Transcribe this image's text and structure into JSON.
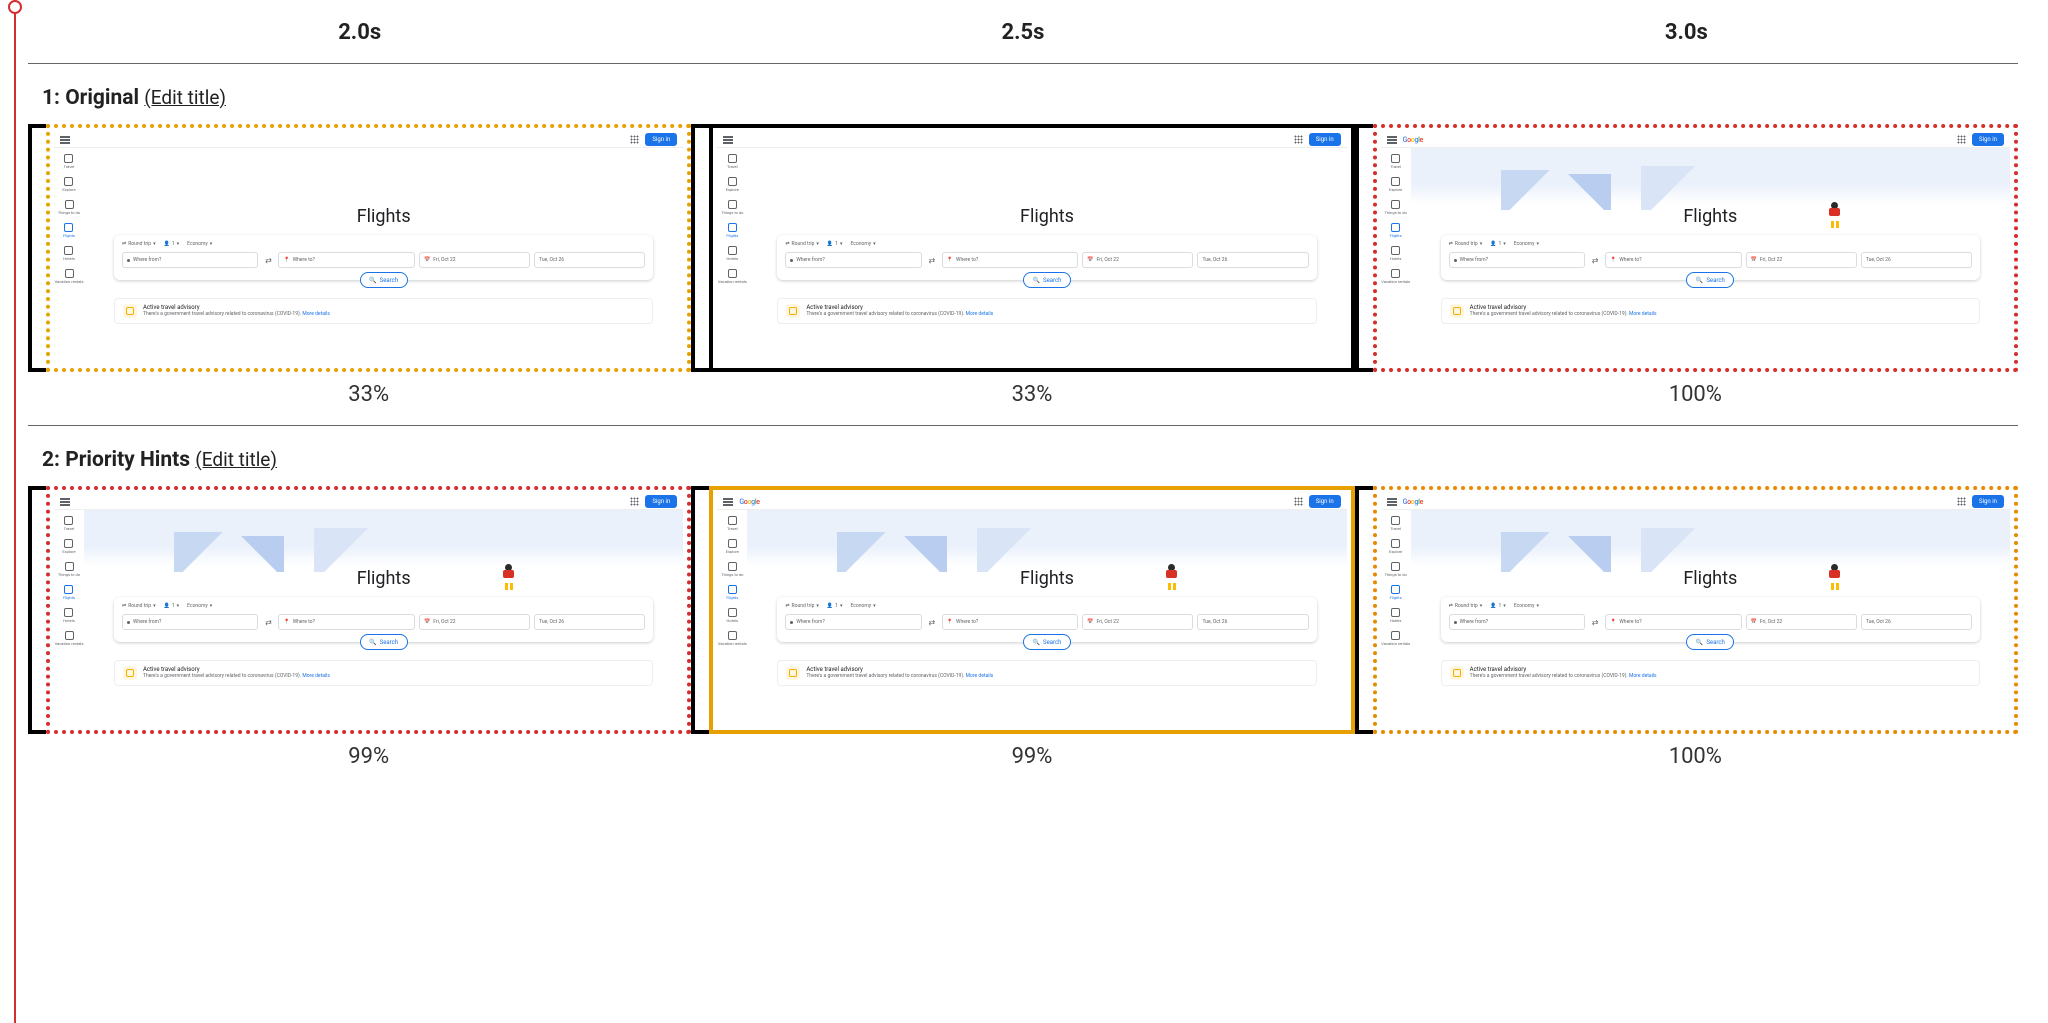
{
  "timeline": {
    "times": [
      "2.0s",
      "2.5s",
      "3.0s"
    ]
  },
  "variants": [
    {
      "num": "1",
      "name": "Original",
      "edit_label": "(Edit title)",
      "frames": [
        {
          "border": "bd-yellow-dot",
          "percent": "33%",
          "hero_loaded": false,
          "logo_loaded": false
        },
        {
          "border": "bd-black",
          "percent": "33%",
          "hero_loaded": false,
          "logo_loaded": false
        },
        {
          "border": "bd-red-dot",
          "percent": "100%",
          "hero_loaded": true,
          "logo_loaded": true
        }
      ]
    },
    {
      "num": "2",
      "name": "Priority Hints",
      "edit_label": "(Edit title)",
      "frames": [
        {
          "border": "bd-red-dot",
          "percent": "99%",
          "hero_loaded": true,
          "logo_loaded": false
        },
        {
          "border": "bd-orange",
          "percent": "99%",
          "hero_loaded": true,
          "logo_loaded": true
        },
        {
          "border": "bd-orange-dot",
          "percent": "100%",
          "hero_loaded": true,
          "logo_loaded": true
        }
      ]
    }
  ],
  "thumb": {
    "signin": "Sign in",
    "page_title": "Flights",
    "sidebar": [
      "Travel",
      "Explore",
      "Things to do",
      "Flights",
      "Hotels",
      "Vacation rentals"
    ],
    "active_sidebar_index": 3,
    "chips": {
      "trip": "Round trip",
      "pax": "1",
      "cabin": "Economy"
    },
    "fields": {
      "from_placeholder": "Where from?",
      "to_placeholder": "Where to?",
      "date1": "Fri, Oct 22",
      "date2": "Tue, Oct 26"
    },
    "search_label": "Search",
    "advisory": {
      "title": "Active travel advisory",
      "body": "There's a government travel advisory related to coronavirus (COVID-19).",
      "link": "More details"
    }
  }
}
